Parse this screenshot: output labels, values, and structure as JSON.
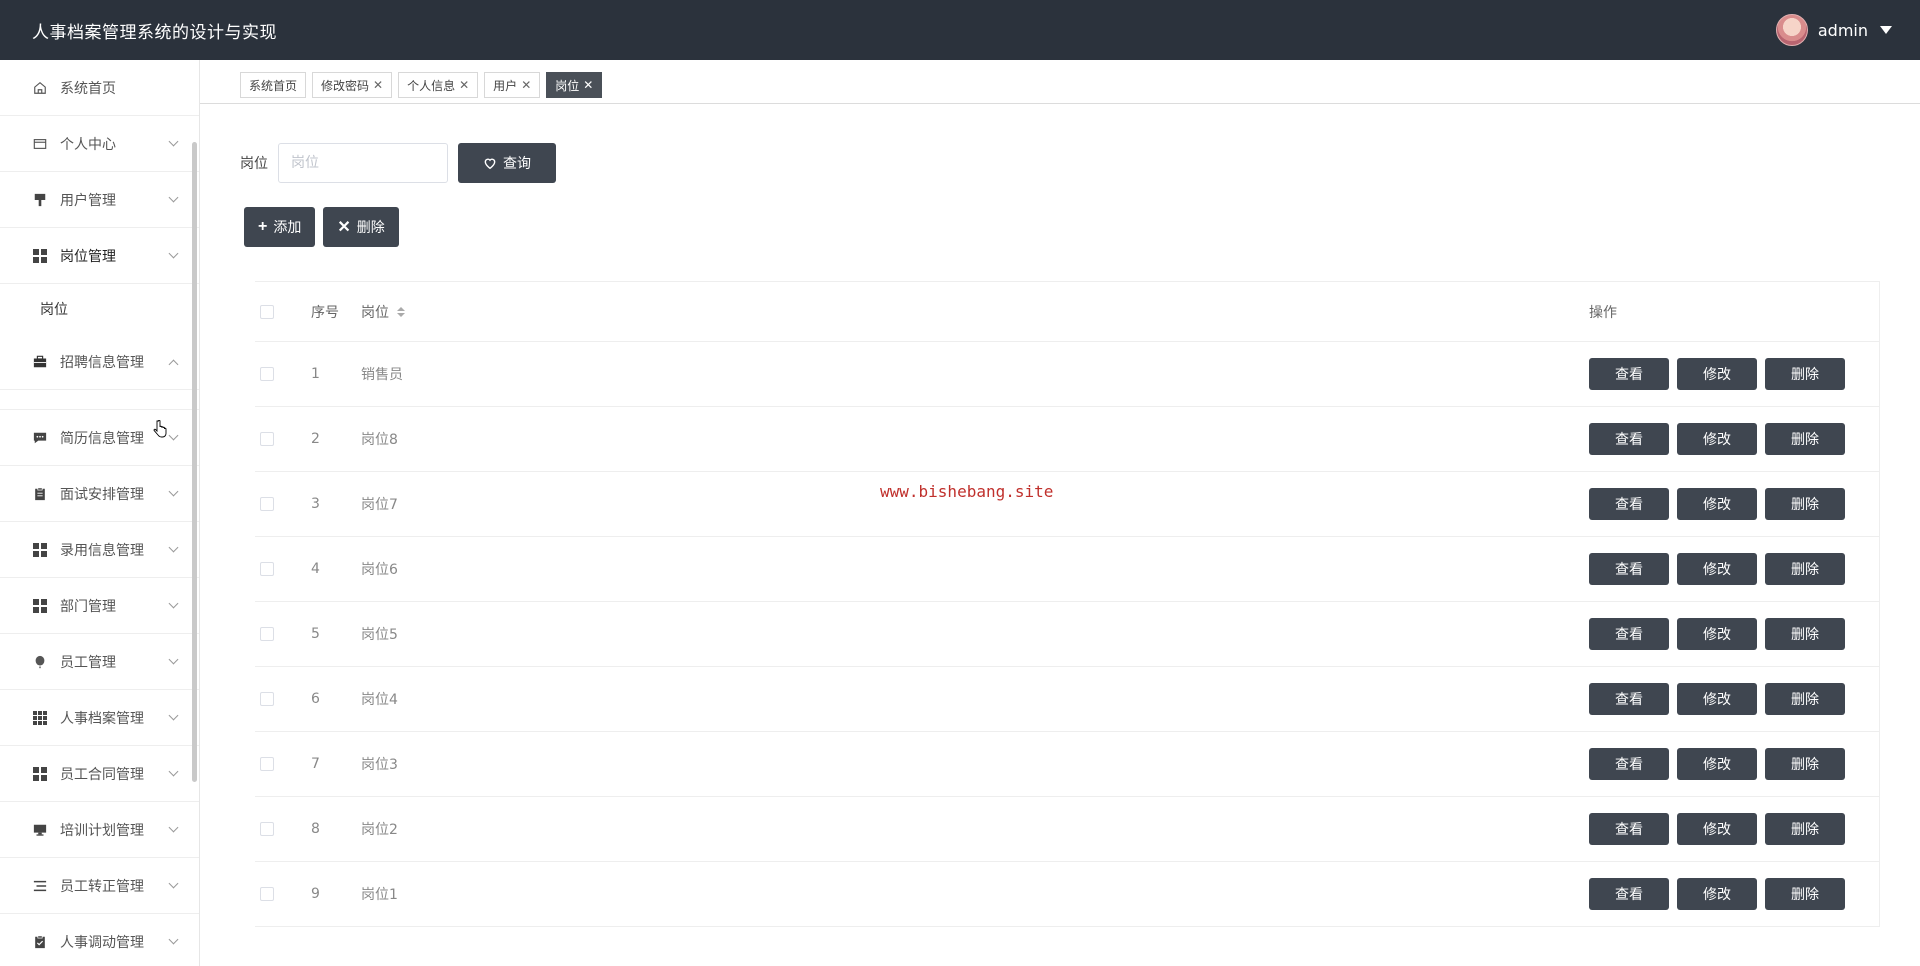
{
  "header": {
    "title": "人事档案管理系统的设计与实现",
    "username": "admin"
  },
  "sidebar": {
    "items": [
      {
        "label": "系统首页",
        "icon": "home-icon",
        "expandable": false
      },
      {
        "label": "个人中心",
        "icon": "wallet-icon",
        "expandable": true
      },
      {
        "label": "用户管理",
        "icon": "brush-icon",
        "expandable": true
      },
      {
        "label": "岗位管理",
        "icon": "grid-icon",
        "expandable": true,
        "active": true,
        "submenu": [
          "岗位"
        ]
      },
      {
        "label": "招聘信息管理",
        "icon": "briefcase-icon",
        "expandable": true,
        "open": true
      },
      {
        "label": "简历信息管理",
        "icon": "chat-icon",
        "expandable": true
      },
      {
        "label": "面试安排管理",
        "icon": "clipboard-icon",
        "expandable": true
      },
      {
        "label": "录用信息管理",
        "icon": "grid-icon",
        "expandable": true
      },
      {
        "label": "部门管理",
        "icon": "grid-icon",
        "expandable": true
      },
      {
        "label": "员工管理",
        "icon": "balloon-icon",
        "expandable": true
      },
      {
        "label": "人事档案管理",
        "icon": "grid9-icon",
        "expandable": true
      },
      {
        "label": "员工合同管理",
        "icon": "grid-icon",
        "expandable": true
      },
      {
        "label": "培训计划管理",
        "icon": "monitor-icon",
        "expandable": true
      },
      {
        "label": "员工转正管理",
        "icon": "list-icon",
        "expandable": true
      },
      {
        "label": "人事调动管理",
        "icon": "clipboard-check-icon",
        "expandable": true
      }
    ]
  },
  "tabs": [
    {
      "label": "系统首页",
      "closable": false
    },
    {
      "label": "修改密码",
      "closable": true
    },
    {
      "label": "个人信息",
      "closable": true
    },
    {
      "label": "用户",
      "closable": true
    },
    {
      "label": "岗位",
      "closable": true,
      "active": true
    }
  ],
  "search": {
    "label": "岗位",
    "placeholder": "岗位",
    "value": "",
    "button_label": "查询"
  },
  "actions": {
    "add_label": "添加",
    "delete_label": "删除"
  },
  "table": {
    "headers": {
      "index": "序号",
      "name": "岗位",
      "ops": "操作"
    },
    "op_labels": {
      "view": "查看",
      "edit": "修改",
      "delete": "删除"
    },
    "rows": [
      {
        "index": "1",
        "name": "销售员"
      },
      {
        "index": "2",
        "name": "岗位8"
      },
      {
        "index": "3",
        "name": "岗位7"
      },
      {
        "index": "4",
        "name": "岗位6"
      },
      {
        "index": "5",
        "name": "岗位5"
      },
      {
        "index": "6",
        "name": "岗位4"
      },
      {
        "index": "7",
        "name": "岗位3"
      },
      {
        "index": "8",
        "name": "岗位2"
      },
      {
        "index": "9",
        "name": "岗位1"
      }
    ]
  },
  "watermark": "www.bishebang.site",
  "colors": {
    "header_bg": "#2b323c",
    "button_bg": "#3f4650",
    "watermark": "#c0302c"
  }
}
